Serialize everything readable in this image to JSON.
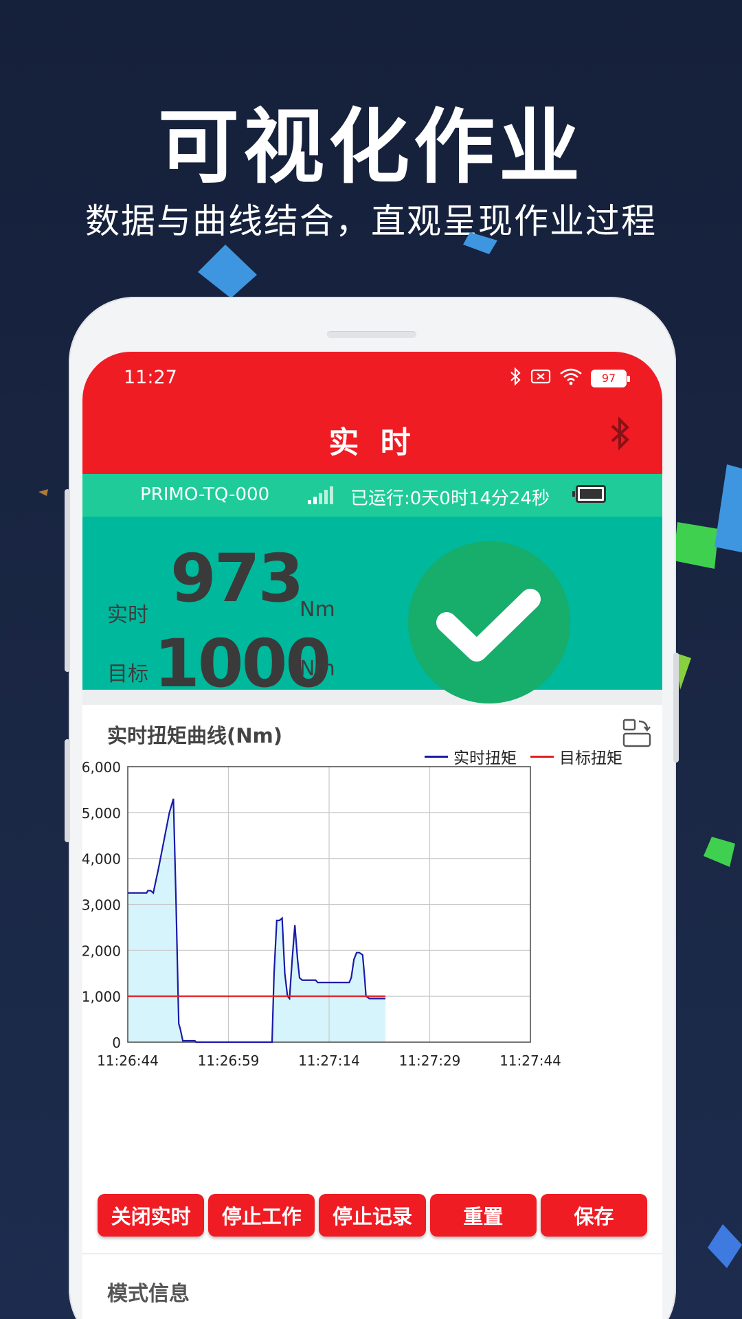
{
  "promo": {
    "headline": "可视化作业",
    "subline": "数据与曲线结合，直观呈现作业过程"
  },
  "status_bar": {
    "time": "11:27",
    "battery": "97"
  },
  "app_bar": {
    "title": "实 时",
    "bluetooth_icon": "bluetooth-icon"
  },
  "device_bar": {
    "device_name": "PRIMO-TQ-000",
    "runtime": "已运行:0天0时14分24秒"
  },
  "measurement": {
    "realtime_label": "实时",
    "realtime_value": "973",
    "realtime_unit": "Nm",
    "target_label": "目标",
    "target_value": "1000",
    "target_unit": "Nm",
    "status_icon": "check-icon",
    "status_color": "#17ad6a"
  },
  "chart_data": {
    "type": "line",
    "title": "实时扭矩曲线(Nm)",
    "ylim": [
      0,
      6000
    ],
    "yticks": [
      "6,000",
      "5,000",
      "4,000",
      "3,000",
      "2,000",
      "1,000",
      "0"
    ],
    "xticks": [
      "11:26:44",
      "11:26:59",
      "11:27:14",
      "11:27:29",
      "11:27:44"
    ],
    "xlim": [
      0,
      60
    ],
    "grid": true,
    "legend_position": "top-right",
    "series": [
      {
        "name": "实时扭矩",
        "color": "#1a1aa8",
        "fill": "#d6f4fb",
        "points": [
          [
            0,
            3250
          ],
          [
            2.8,
            3250
          ],
          [
            3,
            3300
          ],
          [
            3.4,
            3300
          ],
          [
            3.8,
            3250
          ],
          [
            4.6,
            3800
          ],
          [
            5.4,
            4400
          ],
          [
            6.2,
            5000
          ],
          [
            6.8,
            5300
          ],
          [
            7.2,
            3000
          ],
          [
            7.5,
            1000
          ],
          [
            7.6,
            400
          ],
          [
            7.8,
            300
          ],
          [
            8.1,
            100
          ],
          [
            8.2,
            30
          ],
          [
            10,
            30
          ],
          [
            10.2,
            0
          ],
          [
            21.5,
            0
          ],
          [
            21.8,
            1500
          ],
          [
            22.2,
            2650
          ],
          [
            22.6,
            2650
          ],
          [
            23.0,
            2700
          ],
          [
            23.4,
            1500
          ],
          [
            23.8,
            1000
          ],
          [
            24.1,
            950
          ],
          [
            24.5,
            1800
          ],
          [
            24.9,
            2550
          ],
          [
            25.3,
            1800
          ],
          [
            25.6,
            1400
          ],
          [
            26,
            1350
          ],
          [
            28,
            1350
          ],
          [
            28.3,
            1300
          ],
          [
            33,
            1300
          ],
          [
            33.3,
            1400
          ],
          [
            33.7,
            1800
          ],
          [
            34.1,
            1950
          ],
          [
            34.5,
            1950
          ],
          [
            35,
            1900
          ],
          [
            35.3,
            1400
          ],
          [
            35.5,
            1000
          ],
          [
            36,
            950
          ],
          [
            38.4,
            950
          ]
        ]
      },
      {
        "name": "目标扭矩",
        "color": "#e02020",
        "points": [
          [
            0,
            1000
          ],
          [
            38.4,
            1000
          ]
        ]
      }
    ]
  },
  "actions": [
    {
      "label": "关闭实时"
    },
    {
      "label": "停止工作"
    },
    {
      "label": "停止记录"
    },
    {
      "label": "重置"
    },
    {
      "label": "保存"
    }
  ],
  "mode_info": {
    "title": "模式信息"
  }
}
